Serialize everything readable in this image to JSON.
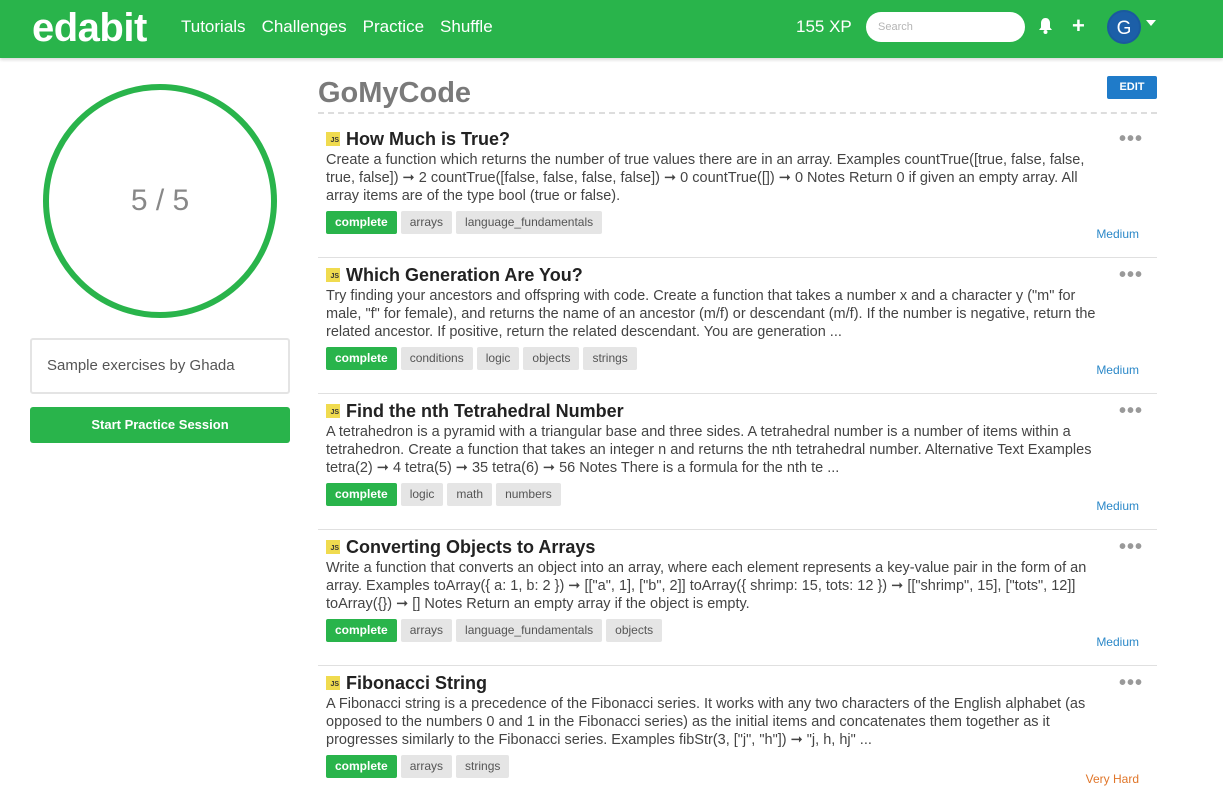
{
  "nav": {
    "logo": "edabit",
    "links": [
      "Tutorials",
      "Challenges",
      "Practice",
      "Shuffle"
    ],
    "xp": "155 XP",
    "search_placeholder": "Search",
    "avatar_initial": "G"
  },
  "sidebar": {
    "progress": "5 / 5",
    "progress_fraction": 1.0,
    "description": "Sample exercises by Ghada",
    "start_button": "Start Practice Session"
  },
  "collection": {
    "title": "GoMyCode",
    "edit_button": "EDIT"
  },
  "challenges": [
    {
      "lang": "JS",
      "title": "How Much is True?",
      "description": "Create a function which returns the number of true values there are in an array. Examples countTrue([true, false, false, true, false]) ➞ 2 countTrue([false, false, false, false]) ➞ 0 countTrue([]) ➞ 0 Notes Return 0 if given an empty array. All array items are of the type bool (true or false).",
      "tags": [
        "complete",
        "arrays",
        "language_fundamentals"
      ],
      "difficulty": "Medium"
    },
    {
      "lang": "JS",
      "title": "Which Generation Are You?",
      "description": "Try finding your ancestors and offspring with code. Create a function that takes a number x and a character y (\"m\" for male, \"f\" for female), and returns the name of an ancestor (m/f) or descendant (m/f). If the number is negative, return the related ancestor. If positive, return the related descendant. You are generation ...",
      "tags": [
        "complete",
        "conditions",
        "logic",
        "objects",
        "strings"
      ],
      "difficulty": "Medium"
    },
    {
      "lang": "JS",
      "title": "Find the nth Tetrahedral Number",
      "description": "A tetrahedron is a pyramid with a triangular base and three sides. A tetrahedral number is a number of items within a tetrahedron. Create a function that takes an integer n and returns the nth tetrahedral number. Alternative Text Examples tetra(2) ➞ 4 tetra(5) ➞ 35 tetra(6) ➞ 56 Notes There is a formula for the nth te ...",
      "tags": [
        "complete",
        "logic",
        "math",
        "numbers"
      ],
      "difficulty": "Medium"
    },
    {
      "lang": "JS",
      "title": "Converting Objects to Arrays",
      "description": "Write a function that converts an object into an array, where each element represents a key-value pair in the form of an array. Examples toArray({ a: 1, b: 2 }) ➞ [[\"a\", 1], [\"b\", 2]] toArray({ shrimp: 15, tots: 12 }) ➞ [[\"shrimp\", 15], [\"tots\", 12]] toArray({}) ➞ [] Notes Return an empty array if the object is empty.",
      "tags": [
        "complete",
        "arrays",
        "language_fundamentals",
        "objects"
      ],
      "difficulty": "Medium"
    },
    {
      "lang": "JS",
      "title": "Fibonacci String",
      "description": "A Fibonacci string is a precedence of the Fibonacci series. It works with any two characters of the English alphabet (as opposed to the numbers 0 and 1 in the Fibonacci series) as the initial items and concatenates them together as it progresses similarly to the Fibonacci series. Examples fibStr(3, [\"j\", \"h\"]) ➞ \"j, h, hj\" ...",
      "tags": [
        "complete",
        "arrays",
        "strings"
      ],
      "difficulty": "Very Hard"
    }
  ],
  "colors": {
    "brand_green": "#29b44b",
    "edit_blue": "#1f7bc9",
    "medium": "#2b88c8",
    "very_hard": "#e0762a"
  }
}
